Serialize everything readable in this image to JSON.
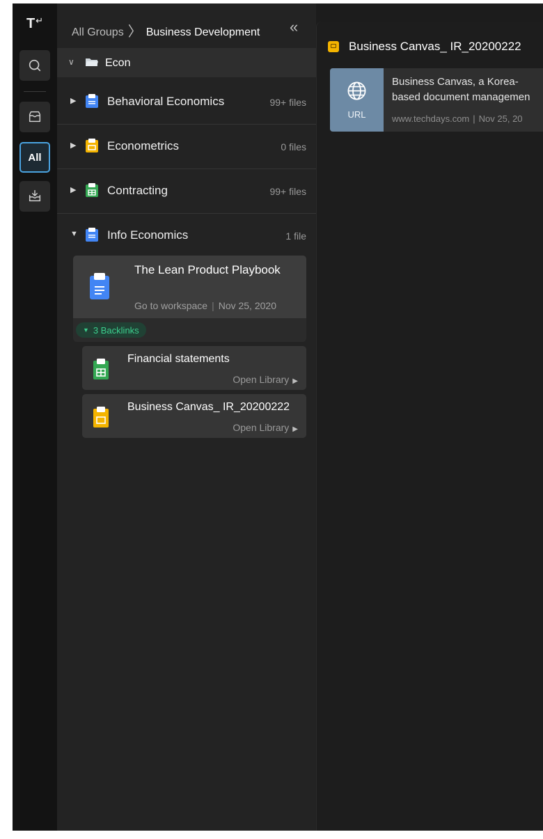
{
  "rail": {
    "logo": "T",
    "logo_mark": "↵",
    "all_label": "All"
  },
  "sidebar": {
    "breadcrumb_root": "All Groups",
    "breadcrumb_current": "Business Development",
    "folder_label": "Econ",
    "groups": [
      {
        "name": "Behavioral Economics",
        "count": "99+ files"
      },
      {
        "name": "Econometrics",
        "count": "0 files"
      },
      {
        "name": "Contracting",
        "count": "99+ files"
      },
      {
        "name": "Info Economics",
        "count": "1 file"
      }
    ],
    "doc_card": {
      "title": "The Lean Product Playbook",
      "link": "Go to workspace",
      "date": "Nov 25, 2020",
      "backlinks": "3 Backlinks"
    },
    "backlink_items": [
      {
        "title": "Financial statements",
        "action": "Open Library"
      },
      {
        "title": "Business Canvas_ IR_20200222",
        "action": "Open Library"
      }
    ]
  },
  "main": {
    "title": "Business Canvas_ IR_20200222",
    "url_card": {
      "thumb_label": "URL",
      "line1": "Business Canvas, a Korea-",
      "line2": "based document managemen",
      "domain": "www.techdays.com",
      "date": "Nov 25, 20"
    }
  },
  "colors": {
    "accent_blue": "#4aa3e0",
    "backlink_green": "#3ccf8e",
    "doc_blue": "#4285f4",
    "sheet_green": "#34a853",
    "slide_yellow": "#f4b400"
  }
}
